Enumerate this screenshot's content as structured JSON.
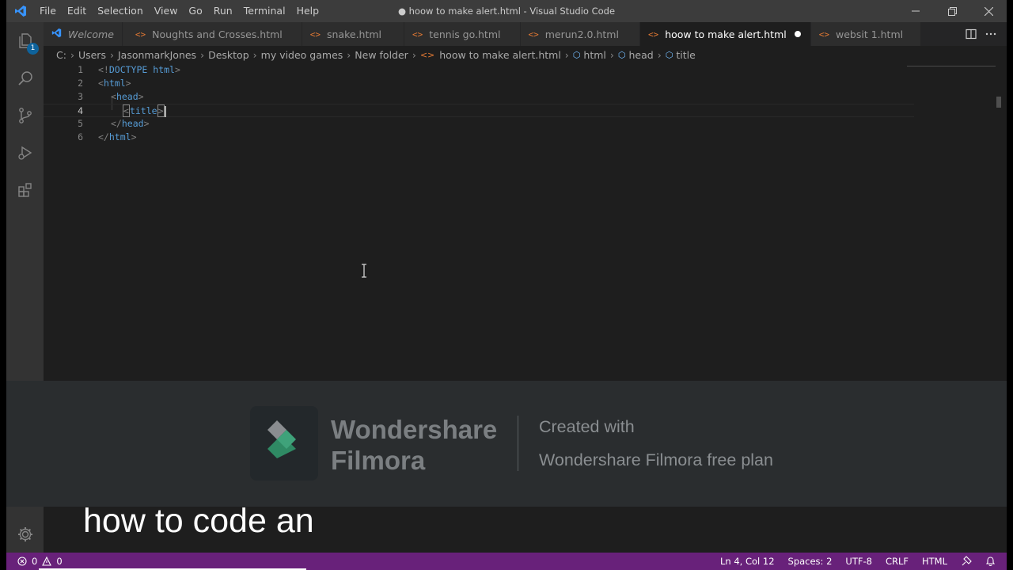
{
  "window": {
    "title": "● hoow to make alert.html - Visual Studio Code"
  },
  "menu": [
    "File",
    "Edit",
    "Selection",
    "View",
    "Go",
    "Run",
    "Terminal",
    "Help"
  ],
  "activity": {
    "explorer_badge": "1"
  },
  "tabs": [
    {
      "label": "Welcome",
      "icon": "vscode-icon"
    },
    {
      "label": "Noughts and Crosses.html",
      "icon": "html-file-icon"
    },
    {
      "label": "snake.html",
      "icon": "html-file-icon"
    },
    {
      "label": "tennis go.html",
      "icon": "html-file-icon"
    },
    {
      "label": "merun2.0.html",
      "icon": "html-file-icon"
    },
    {
      "label": "hoow to make alert.html",
      "icon": "html-file-icon",
      "active": true,
      "dirty": true
    },
    {
      "label": "websit 1.html",
      "icon": "html-file-icon"
    }
  ],
  "breadcrumb": {
    "path": [
      "C:",
      "Users",
      "JasonmarkJones",
      "Desktop",
      "my video games",
      "New folder"
    ],
    "file": "hoow to make alert.html",
    "symbols": [
      "html",
      "head",
      "title"
    ]
  },
  "editor": {
    "line_numbers": [
      "1",
      "2",
      "3",
      "4",
      "5",
      "6"
    ],
    "current_line": 4,
    "lines": [
      {
        "open": "<!",
        "tag": "DOCTYPE",
        "attr": " html",
        "close": ">"
      },
      {
        "open": "<",
        "tag": "html",
        "close": ">"
      },
      {
        "open": "<",
        "tag": "head",
        "close": ">"
      },
      {
        "open": "<",
        "tag": "title",
        "close": ">"
      },
      {
        "open": "</",
        "tag": "head",
        "close": ">"
      },
      {
        "open": "</",
        "tag": "html",
        "close": ">"
      }
    ]
  },
  "watermark": {
    "brand_line1": "Wondershare",
    "brand_line2": "Filmora",
    "created": "Created with",
    "plan": "Wondershare Filmora free plan"
  },
  "caption": "how to code an",
  "status": {
    "errors": "0",
    "warnings": "0",
    "position": "Ln 4, Col 12",
    "spaces": "Spaces: 2",
    "encoding": "UTF-8",
    "eol": "CRLF",
    "language": "HTML"
  },
  "colors": {
    "statusbar": "#68217a",
    "titlebar": "#3c3c3c",
    "editor": "#1e1e1e",
    "file_icon": "#e37933"
  }
}
